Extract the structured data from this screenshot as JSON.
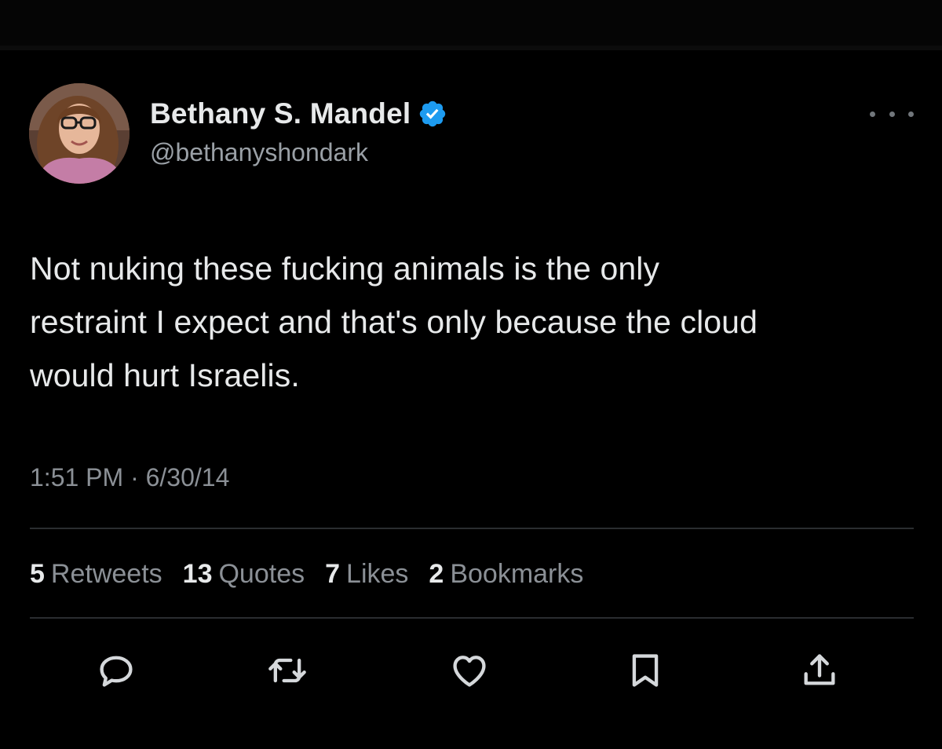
{
  "author": {
    "display_name": "Bethany S. Mandel",
    "handle": "@bethanyshondark",
    "verified": true,
    "avatar_icon": "profile-photo",
    "verified_icon": "verified-badge-icon",
    "verified_color": "#1d9bf0"
  },
  "tweet": {
    "lines": [
      "Not nuking these fucking animals is the only",
      "restraint I expect and that's only because the cloud",
      "would hurt Israelis."
    ],
    "timestamp": "1:51 PM · 6/30/14"
  },
  "stats": {
    "retweets_count": "5",
    "retweets_label": "Retweets",
    "quotes_count": "13",
    "quotes_label": "Quotes",
    "likes_count": "7",
    "likes_label": "Likes",
    "bookmarks_count": "2",
    "bookmarks_label": "Bookmarks"
  },
  "actions": {
    "reply_icon": "reply-icon",
    "retweet_icon": "retweet-icon",
    "like_icon": "heart-icon",
    "bookmark_icon": "bookmark-icon",
    "share_icon": "share-icon"
  },
  "colors": {
    "background": "#000000",
    "primary_text": "#e7e9ea",
    "secondary_text": "#8b9096",
    "divider": "#2a2d30"
  }
}
